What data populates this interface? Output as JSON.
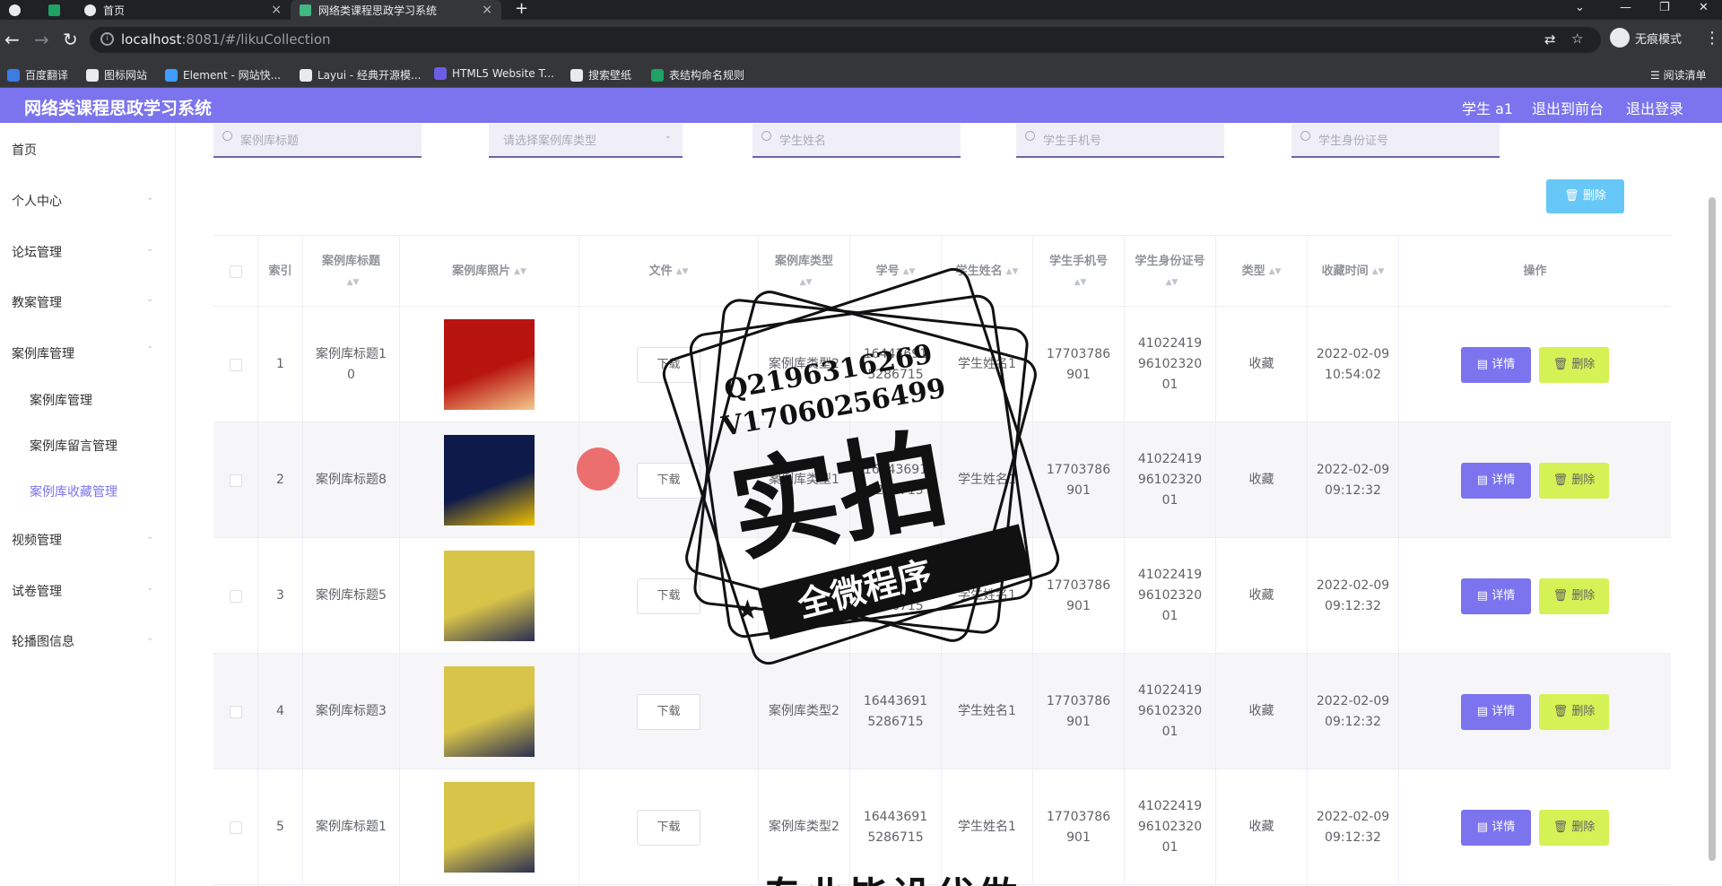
{
  "browser": {
    "tab1_title": "首页",
    "tab2_title": "网络类课程思政学习系统",
    "new_tab": "+",
    "url_host": "localhost",
    "url_path": ":8081/#/likuCollection",
    "incognito_label": "无痕模式",
    "reading_list": "阅读清单",
    "bookmarks": [
      "百度翻译",
      "图标网站",
      "Element - 网站快...",
      "Layui - 经典开源模...",
      "HTML5 Website T...",
      "搜索壁纸",
      "表结构命名规则"
    ]
  },
  "header": {
    "title": "网络类课程思政学习系统",
    "user": "学生 a1",
    "front": "退出到前台",
    "logout": "退出登录"
  },
  "sidebar": {
    "items": [
      "首页",
      "个人中心",
      "论坛管理",
      "教案管理",
      "案例库管理",
      "视频管理",
      "试卷管理",
      "轮播图信息"
    ],
    "sub": [
      "案例库管理",
      "案例库留言管理",
      "案例库收藏管理"
    ]
  },
  "search": {
    "title_ph": "案例库标题",
    "type_ph": "请选择案例库类型",
    "name_ph": "学生姓名",
    "phone_ph": "学生手机号",
    "id_ph": "学生身份证号"
  },
  "toolbar": {
    "delete": "删除"
  },
  "table": {
    "headers": {
      "index": "索引",
      "title": "案例库标题",
      "photo": "案例库照片",
      "file": "文件",
      "type": "案例库类型",
      "xuehao": "学号",
      "name": "学生姓名",
      "phone": "学生手机号",
      "idcard": "学生身份证号",
      "kind": "类型",
      "time": "收藏时间",
      "ops": "操作"
    },
    "download": "下载",
    "detail": "详情",
    "delete": "删除",
    "rows": [
      {
        "index": "1",
        "title": "案例库标题10",
        "type": "案例库类型2",
        "xuehao": "164436915286715",
        "name": "学生姓名1",
        "phone": "17703786901",
        "idcard": "410224199610232001",
        "kind": "收藏",
        "time": "2022-02-09 10:54:02"
      },
      {
        "index": "2",
        "title": "案例库标题8",
        "type": "案例库类型1",
        "xuehao": "164436915286715",
        "name": "学生姓名1",
        "phone": "17703786901",
        "idcard": "410224199610232001",
        "kind": "收藏",
        "time": "2022-02-09 09:12:32"
      },
      {
        "index": "3",
        "title": "案例库标题5",
        "type": "案例库类型1",
        "xuehao": "164436915286715",
        "name": "学生姓名1",
        "phone": "17703786901",
        "idcard": "410224199610232001",
        "kind": "收藏",
        "time": "2022-02-09 09:12:32"
      },
      {
        "index": "4",
        "title": "案例库标题3",
        "type": "案例库类型2",
        "xuehao": "164436915286715",
        "name": "学生姓名1",
        "phone": "17703786901",
        "idcard": "410224199610232001",
        "kind": "收藏",
        "time": "2022-02-09 09:12:32"
      },
      {
        "index": "5",
        "title": "案例库标题1",
        "type": "案例库类型2",
        "xuehao": "164436915286715",
        "name": "学生姓名1",
        "phone": "17703786901",
        "idcard": "410224199610232001",
        "kind": "收藏",
        "time": "2022-02-09 09:12:32"
      }
    ]
  },
  "watermark": {
    "line1": "Q2196316269",
    "line2": "V17060256499",
    "big": "实拍",
    "ribbon": "全微程序"
  },
  "bottom_text": "专业毕设代做",
  "colors": {
    "accent": "#7b74ee",
    "danger_light": "#d4f255",
    "bulk_delete": "#67c8f7"
  }
}
